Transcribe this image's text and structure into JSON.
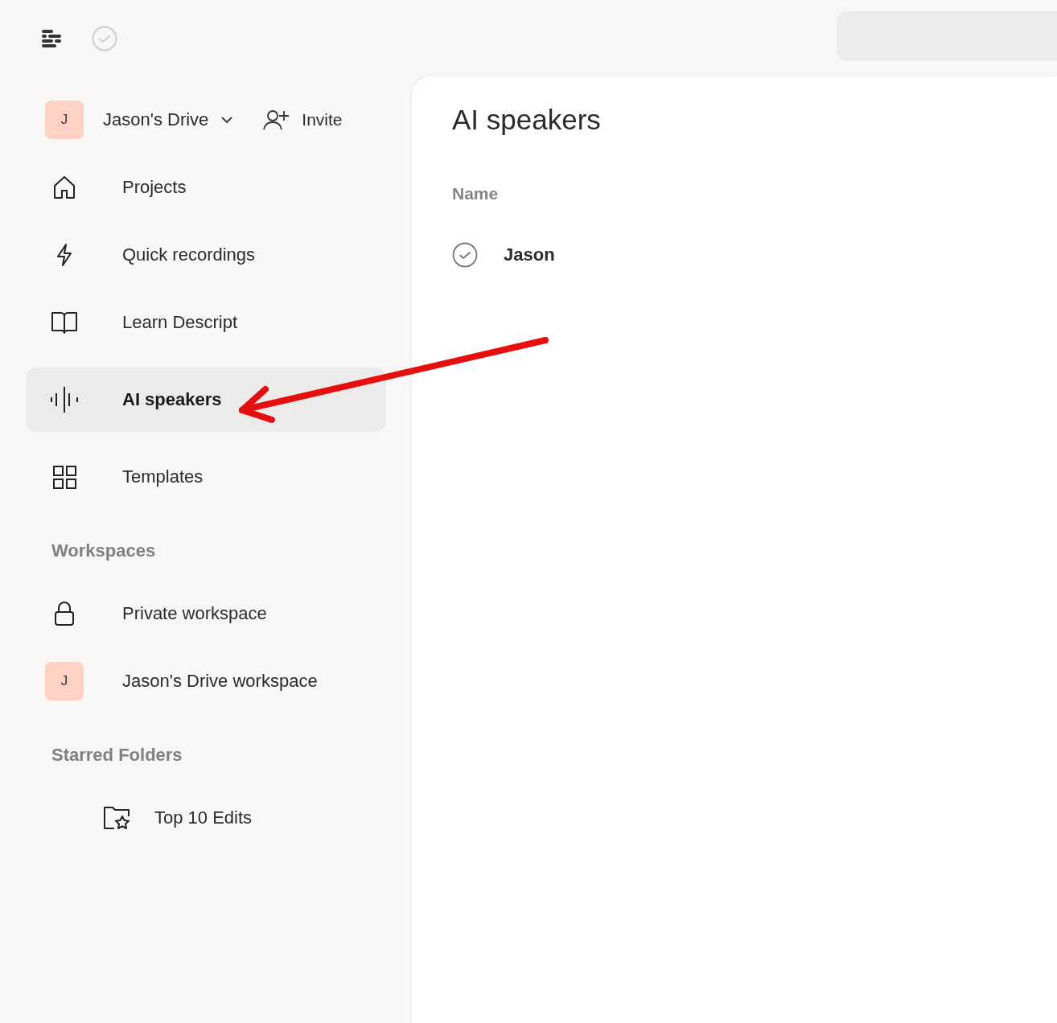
{
  "drive": {
    "initial": "J",
    "name": "Jason's Drive",
    "invite": "Invite"
  },
  "nav": [
    {
      "label": "Projects",
      "selected": false
    },
    {
      "label": "Quick recordings",
      "selected": false
    },
    {
      "label": "Learn Descript",
      "selected": false
    },
    {
      "label": "AI speakers",
      "selected": true
    },
    {
      "label": "Templates",
      "selected": false
    }
  ],
  "workspaces": {
    "heading": "Workspaces",
    "items": [
      {
        "kind": "icon",
        "label": "Private workspace"
      },
      {
        "kind": "avatar",
        "initial": "J",
        "label": "Jason's Drive workspace"
      }
    ]
  },
  "starred": {
    "heading": "Starred Folders",
    "items": [
      {
        "label": "Top 10 Edits"
      }
    ]
  },
  "main": {
    "title": "AI speakers",
    "column": "Name",
    "rows": [
      {
        "name": "Jason"
      }
    ]
  }
}
